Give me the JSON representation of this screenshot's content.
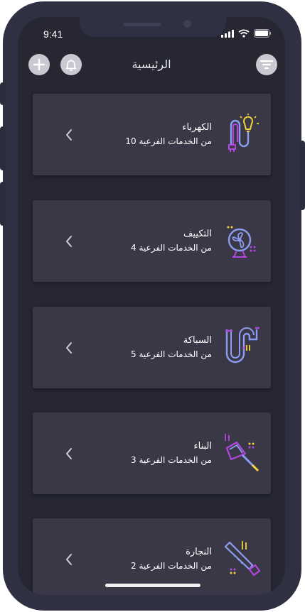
{
  "status": {
    "time": "9:41"
  },
  "header": {
    "title": "الرئيسية"
  },
  "cards": [
    {
      "title": "الكهرباء",
      "subtitle_prefix": "من الخدمات الفرعية",
      "count": "10",
      "icon": "electricity-icon"
    },
    {
      "title": "التكييف",
      "subtitle_prefix": "من الخدمات الفرعية",
      "count": "4",
      "icon": "fan-icon"
    },
    {
      "title": "السباكة",
      "subtitle_prefix": "من الخدمات الفرعية",
      "count": "5",
      "icon": "plumbing-pipe-icon"
    },
    {
      "title": "البناء",
      "subtitle_prefix": "من الخدمات الفرعية",
      "count": "3",
      "icon": "trowel-icon"
    },
    {
      "title": "النجارة",
      "subtitle_prefix": "من الخدمات الفرعية",
      "count": "2",
      "icon": "saw-icon"
    }
  ],
  "colors": {
    "background": "#262733",
    "card": "#3a3847",
    "accent_purple": "#b146e0",
    "accent_blue": "#8c9cf0",
    "accent_yellow": "#f1d33b"
  }
}
